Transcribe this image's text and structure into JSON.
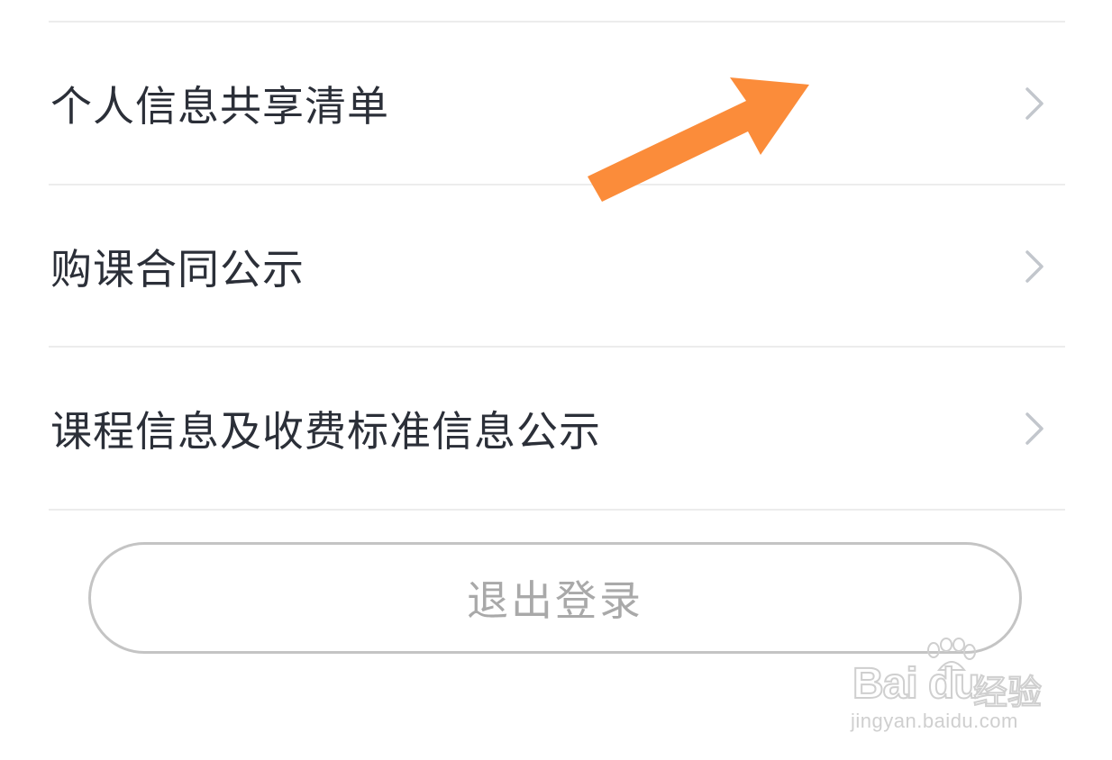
{
  "menu": {
    "items": [
      {
        "label": "个人信息共享清单"
      },
      {
        "label": "购课合同公示"
      },
      {
        "label": "课程信息及收费标准信息公示"
      }
    ]
  },
  "logout": {
    "label": "退出登录"
  },
  "watermark": {
    "brand": "Bai du",
    "product": "经验",
    "url": "jingyan.baidu.com"
  },
  "colors": {
    "text": "#2b2f38",
    "divider": "#ececec",
    "chevron": "#c2c6cc",
    "button_border": "#c4c4c4",
    "button_text": "#a9a9a9",
    "arrow": "#fb8c3a"
  },
  "icons": {
    "chevron": "chevron-right-icon",
    "arrow": "arrow-up-right-icon",
    "paw": "paw-icon"
  }
}
